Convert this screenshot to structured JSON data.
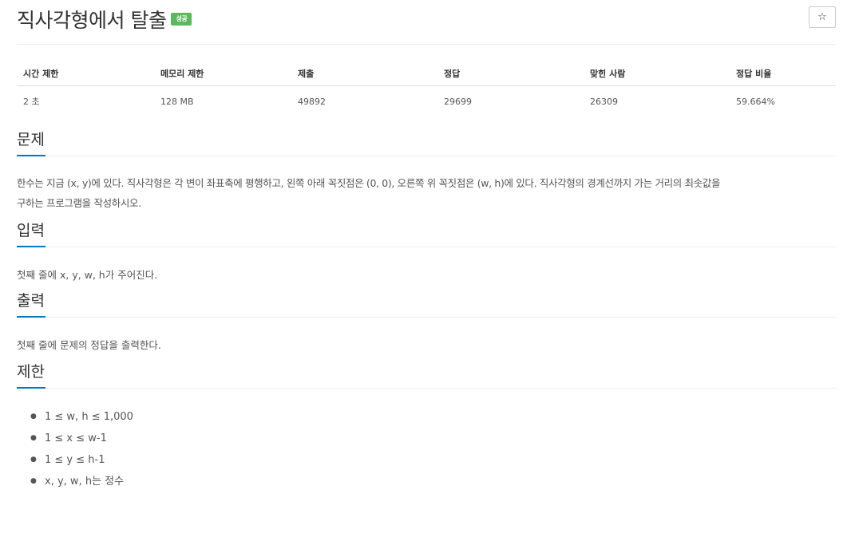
{
  "problem": {
    "title": "직사각형에서 탈출",
    "status_badge": "성공",
    "star_label": "☆"
  },
  "info_table": {
    "headers": [
      "시간 제한",
      "메모리 제한",
      "제출",
      "정답",
      "맞힌 사람",
      "정답 비율"
    ],
    "values": [
      "2 초",
      "128 MB",
      "49892",
      "29699",
      "26309",
      "59.664%"
    ]
  },
  "sections": {
    "description": {
      "title": "문제",
      "line1": "한수는 지금 (x, y)에 있다. 직사각형은 각 변이 좌표축에 평행하고, 왼쪽 아래 꼭짓점은 (0, 0), 오른쪽 위 꼭짓점은 (w, h)에 있다. 직사각형의 경계선까지 가는 거리의 최솟값을",
      "line2": "구하는 프로그램을 작성하시오."
    },
    "input": {
      "title": "입력",
      "text": "첫째 줄에 x, y, w, h가 주어진다."
    },
    "output": {
      "title": "출력",
      "text": "첫째 줄에 문제의 정답을 출력한다."
    },
    "limits": {
      "title": "제한",
      "items": [
        "1 ≤ w, h ≤ 1,000",
        "1 ≤ x ≤ w-1",
        "1 ≤ y ≤ h-1",
        "x, y, w, h는 정수"
      ]
    }
  },
  "colors": {
    "badge": "#5cb85c",
    "underline": "#0076c0"
  }
}
